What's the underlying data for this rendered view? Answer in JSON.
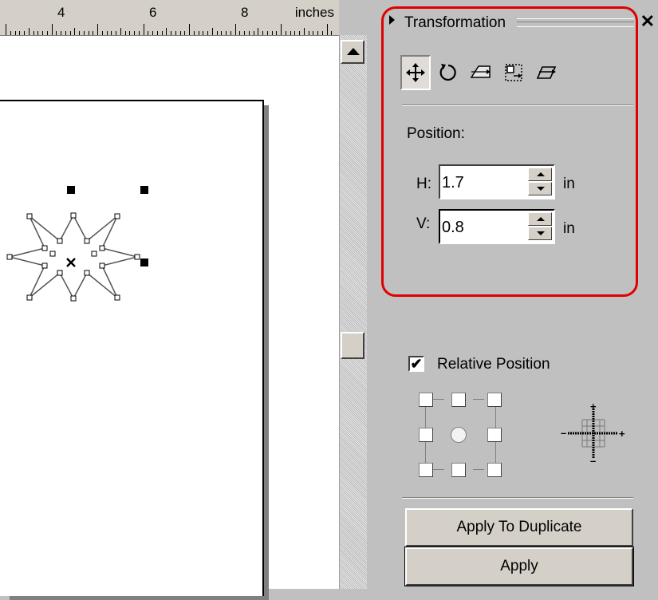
{
  "ruler": {
    "labels": [
      "4",
      "6",
      "8"
    ],
    "unit": "inches"
  },
  "panel": {
    "title": "Transformation",
    "close_glyph": "✕",
    "tools": [
      {
        "name": "position-tool",
        "icon": "move-arrows-icon",
        "active": true
      },
      {
        "name": "rotate-tool",
        "icon": "rotate-icon",
        "active": false
      },
      {
        "name": "scale-mirror-tool",
        "icon": "scale-mirror-icon",
        "active": false
      },
      {
        "name": "size-tool",
        "icon": "size-icon",
        "active": false
      },
      {
        "name": "skew-tool",
        "icon": "skew-icon",
        "active": false
      }
    ],
    "position_label": "Position:",
    "h": {
      "label": "H:",
      "value": "1.7",
      "unit": "in"
    },
    "v": {
      "label": "V:",
      "value": "0.8",
      "unit": "in"
    },
    "relative_position": {
      "label": "Relative Position",
      "checked": "✔"
    },
    "buttons": {
      "apply_duplicate": "Apply To Duplicate",
      "apply": "Apply"
    },
    "highlight_color": "#e00000"
  }
}
